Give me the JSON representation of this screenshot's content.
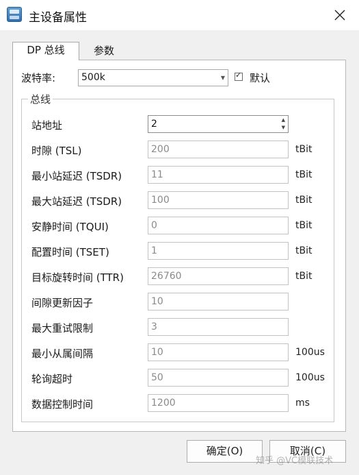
{
  "window": {
    "title": "主设备属性",
    "app_icon": "network-device-icon",
    "close_icon": "close-icon"
  },
  "tabs": [
    {
      "label": "DP 总线",
      "selected": true
    },
    {
      "label": "参数",
      "selected": false
    }
  ],
  "baud": {
    "label": "波特率:",
    "value": "500k",
    "default_label": "默认",
    "default_checked": true
  },
  "group": {
    "title": "总线"
  },
  "fields": [
    {
      "label": "站地址",
      "value": "2",
      "unit": ""
    },
    {
      "label": "时隙 (TSL)",
      "value": "200",
      "unit": "tBit"
    },
    {
      "label": "最小站延迟 (TSDR)",
      "value": "11",
      "unit": "tBit"
    },
    {
      "label": "最大站延迟 (TSDR)",
      "value": "100",
      "unit": "tBit"
    },
    {
      "label": "安静时间 (TQUI)",
      "value": "0",
      "unit": "tBit"
    },
    {
      "label": "配置时间 (TSET)",
      "value": "1",
      "unit": "tBit"
    },
    {
      "label": "目标旋转时间 (TTR)",
      "value": "26760",
      "unit": "tBit"
    },
    {
      "label": "间隙更新因子",
      "value": "10",
      "unit": ""
    },
    {
      "label": "最大重试限制",
      "value": "3",
      "unit": ""
    },
    {
      "label": "最小从属间隔",
      "value": "10",
      "unit": "100us"
    },
    {
      "label": "轮询超时",
      "value": "50",
      "unit": "100us"
    },
    {
      "label": "数据控制时间",
      "value": "1200",
      "unit": "ms"
    }
  ],
  "buttons": {
    "ok": "确定(O)",
    "cancel": "取消(C)"
  },
  "watermark": "知乎 @VC模联技术"
}
